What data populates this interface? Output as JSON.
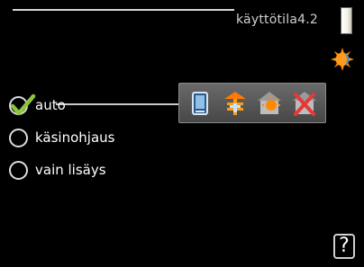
{
  "header": {
    "title": "käyttötila4.2"
  },
  "icons": {
    "page_indicator": "page-indicator-bar",
    "mode_status": "sun-heating-icon",
    "help": "help-icon"
  },
  "options": [
    {
      "label": "auto",
      "selected": true
    },
    {
      "label": "käsinohjaus",
      "selected": false
    },
    {
      "label": "vain lisäys",
      "selected": false
    }
  ],
  "mode_icons": [
    "tank-icon",
    "additional-heat-icon",
    "heating-icon",
    "cooling-off-icon"
  ],
  "help": {
    "label": "?"
  },
  "colors": {
    "background": "#000000",
    "checkmark": "#8cc63f",
    "accent_orange": "#ff8a00",
    "panel": "#555555"
  }
}
